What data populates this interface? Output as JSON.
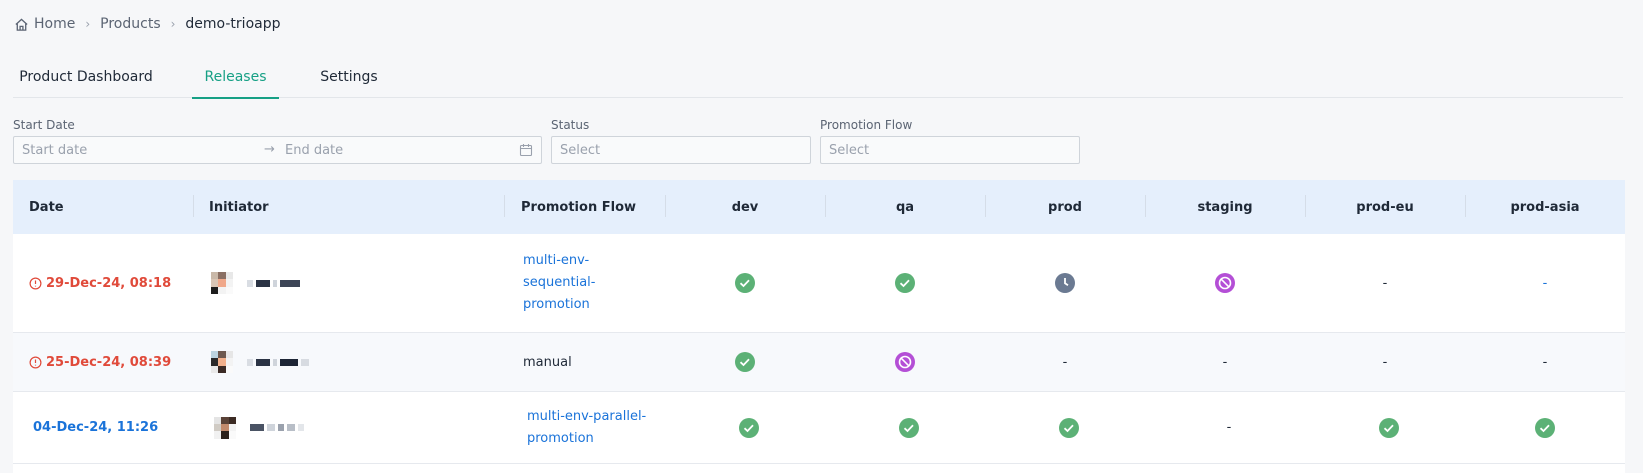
{
  "breadcrumb": [
    {
      "label": "Home"
    },
    {
      "label": "Products"
    },
    {
      "label": "demo-trioapp"
    }
  ],
  "tabs": [
    {
      "label": "Product Dashboard",
      "active": false
    },
    {
      "label": "Releases",
      "active": true
    },
    {
      "label": "Settings",
      "active": false
    }
  ],
  "filters": {
    "start_date_label": "Start Date",
    "start_placeholder": "Start date",
    "end_placeholder": "End date",
    "range_separator": "→",
    "status_label": "Status",
    "status_placeholder": "Select",
    "flow_label": "Promotion Flow",
    "flow_placeholder": "Select"
  },
  "table": {
    "columns": [
      "Date",
      "Initiator",
      "Promotion Flow",
      "dev",
      "qa",
      "prod",
      "staging",
      "prod-eu",
      "prod-asia"
    ],
    "rows": [
      {
        "date": "29-Dec-24, 08:18",
        "date_status": "error",
        "flow_lines": [
          "multi-env-",
          "sequential-",
          "promotion"
        ],
        "flow_is_link": true,
        "envs": [
          "success",
          "success",
          "pending",
          "blocked",
          "-",
          "-"
        ]
      },
      {
        "date": "25-Dec-24, 08:39",
        "date_status": "error",
        "flow_lines": [
          "manual"
        ],
        "flow_is_link": false,
        "envs": [
          "success",
          "blocked",
          "-",
          "-",
          "-",
          "-"
        ]
      },
      {
        "date": "04-Dec-24, 11:26",
        "date_status": "normal",
        "flow_lines": [
          "multi-env-parallel-",
          "promotion"
        ],
        "flow_is_link": true,
        "envs": [
          "success",
          "success",
          "success",
          "-",
          "success",
          "success"
        ]
      }
    ]
  },
  "colors": {
    "accent": "#16a085",
    "success": "#5cb176",
    "pending": "#6b7a92",
    "blocked": "#b44fd6",
    "error": "#e04a3a",
    "link": "#1a73d9"
  }
}
